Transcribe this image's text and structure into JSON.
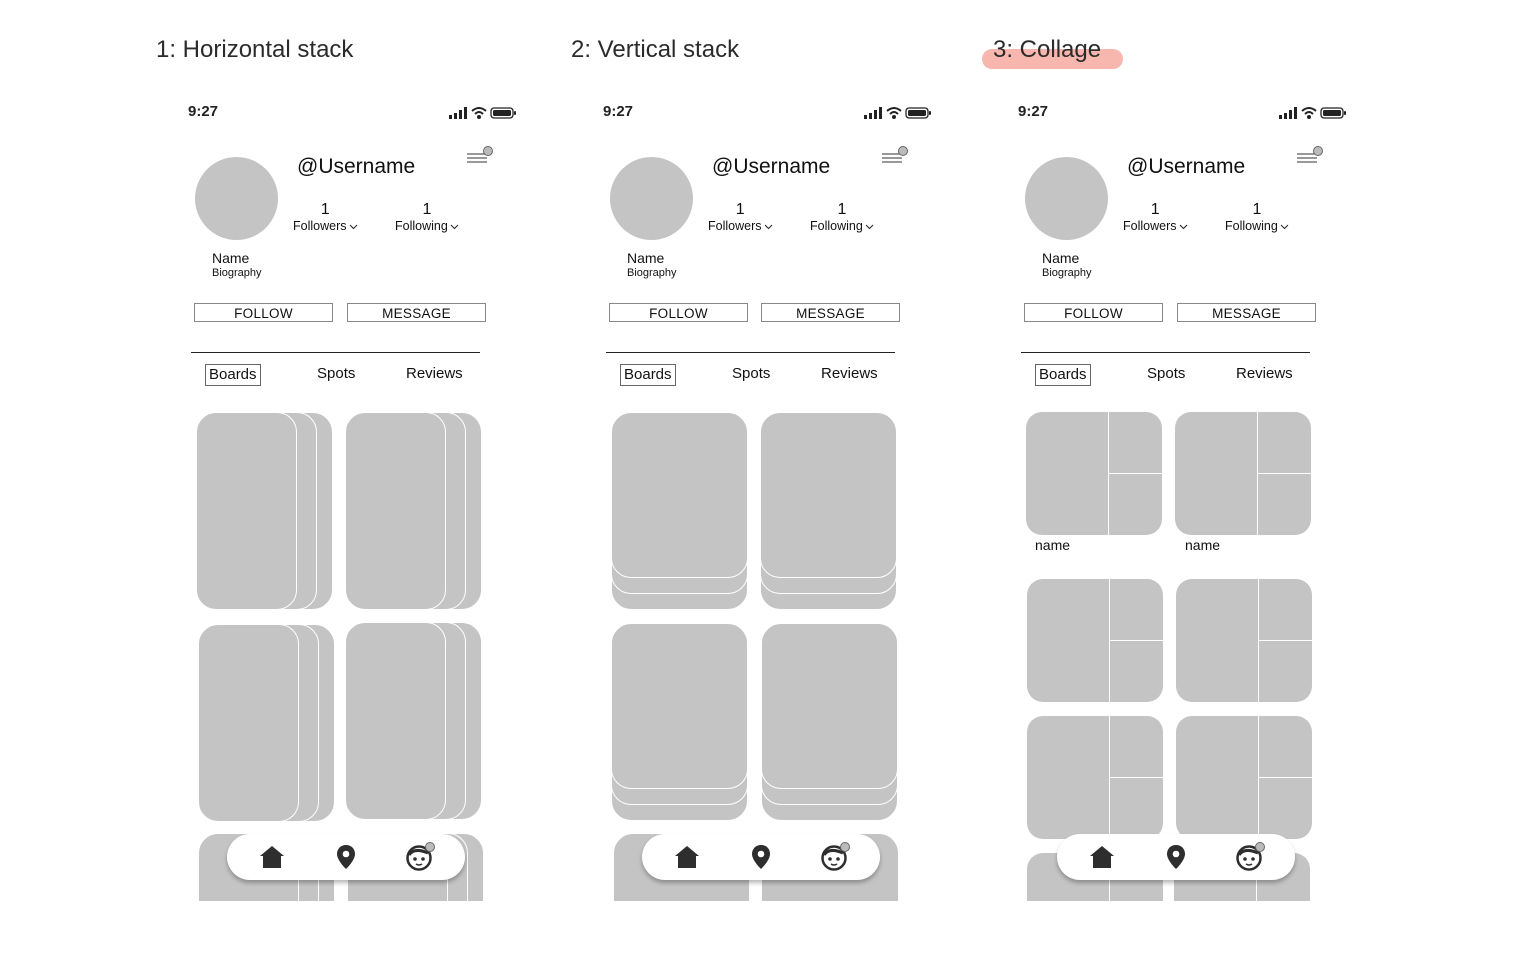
{
  "variants": [
    {
      "title": "1: Horizontal stack",
      "style": "horizontal-stack"
    },
    {
      "title": "2: Vertical stack",
      "style": "vertical-stack"
    },
    {
      "title": "3: Collage",
      "style": "collage",
      "highlight_color": "#f8b7ae"
    }
  ],
  "profile": {
    "time": "9:27",
    "username": "@Username",
    "followers_count": "1",
    "followers_label": "Followers",
    "following_count": "1",
    "following_label": "Following",
    "name": "Name",
    "bio": "Biography",
    "follow_label": "FOLLOW",
    "message_label": "MESSAGE",
    "tabs": [
      "Boards",
      "Spots",
      "Reviews"
    ],
    "active_tab": "Boards"
  },
  "collage": {
    "board_names": [
      "name",
      "name"
    ]
  },
  "nav": {
    "items": [
      "home-icon",
      "location-pin-icon",
      "profile-face-icon"
    ]
  },
  "colors": {
    "placeholder": "#c4c4c4",
    "text": "#222222",
    "highlight": "#f8b7ae"
  }
}
